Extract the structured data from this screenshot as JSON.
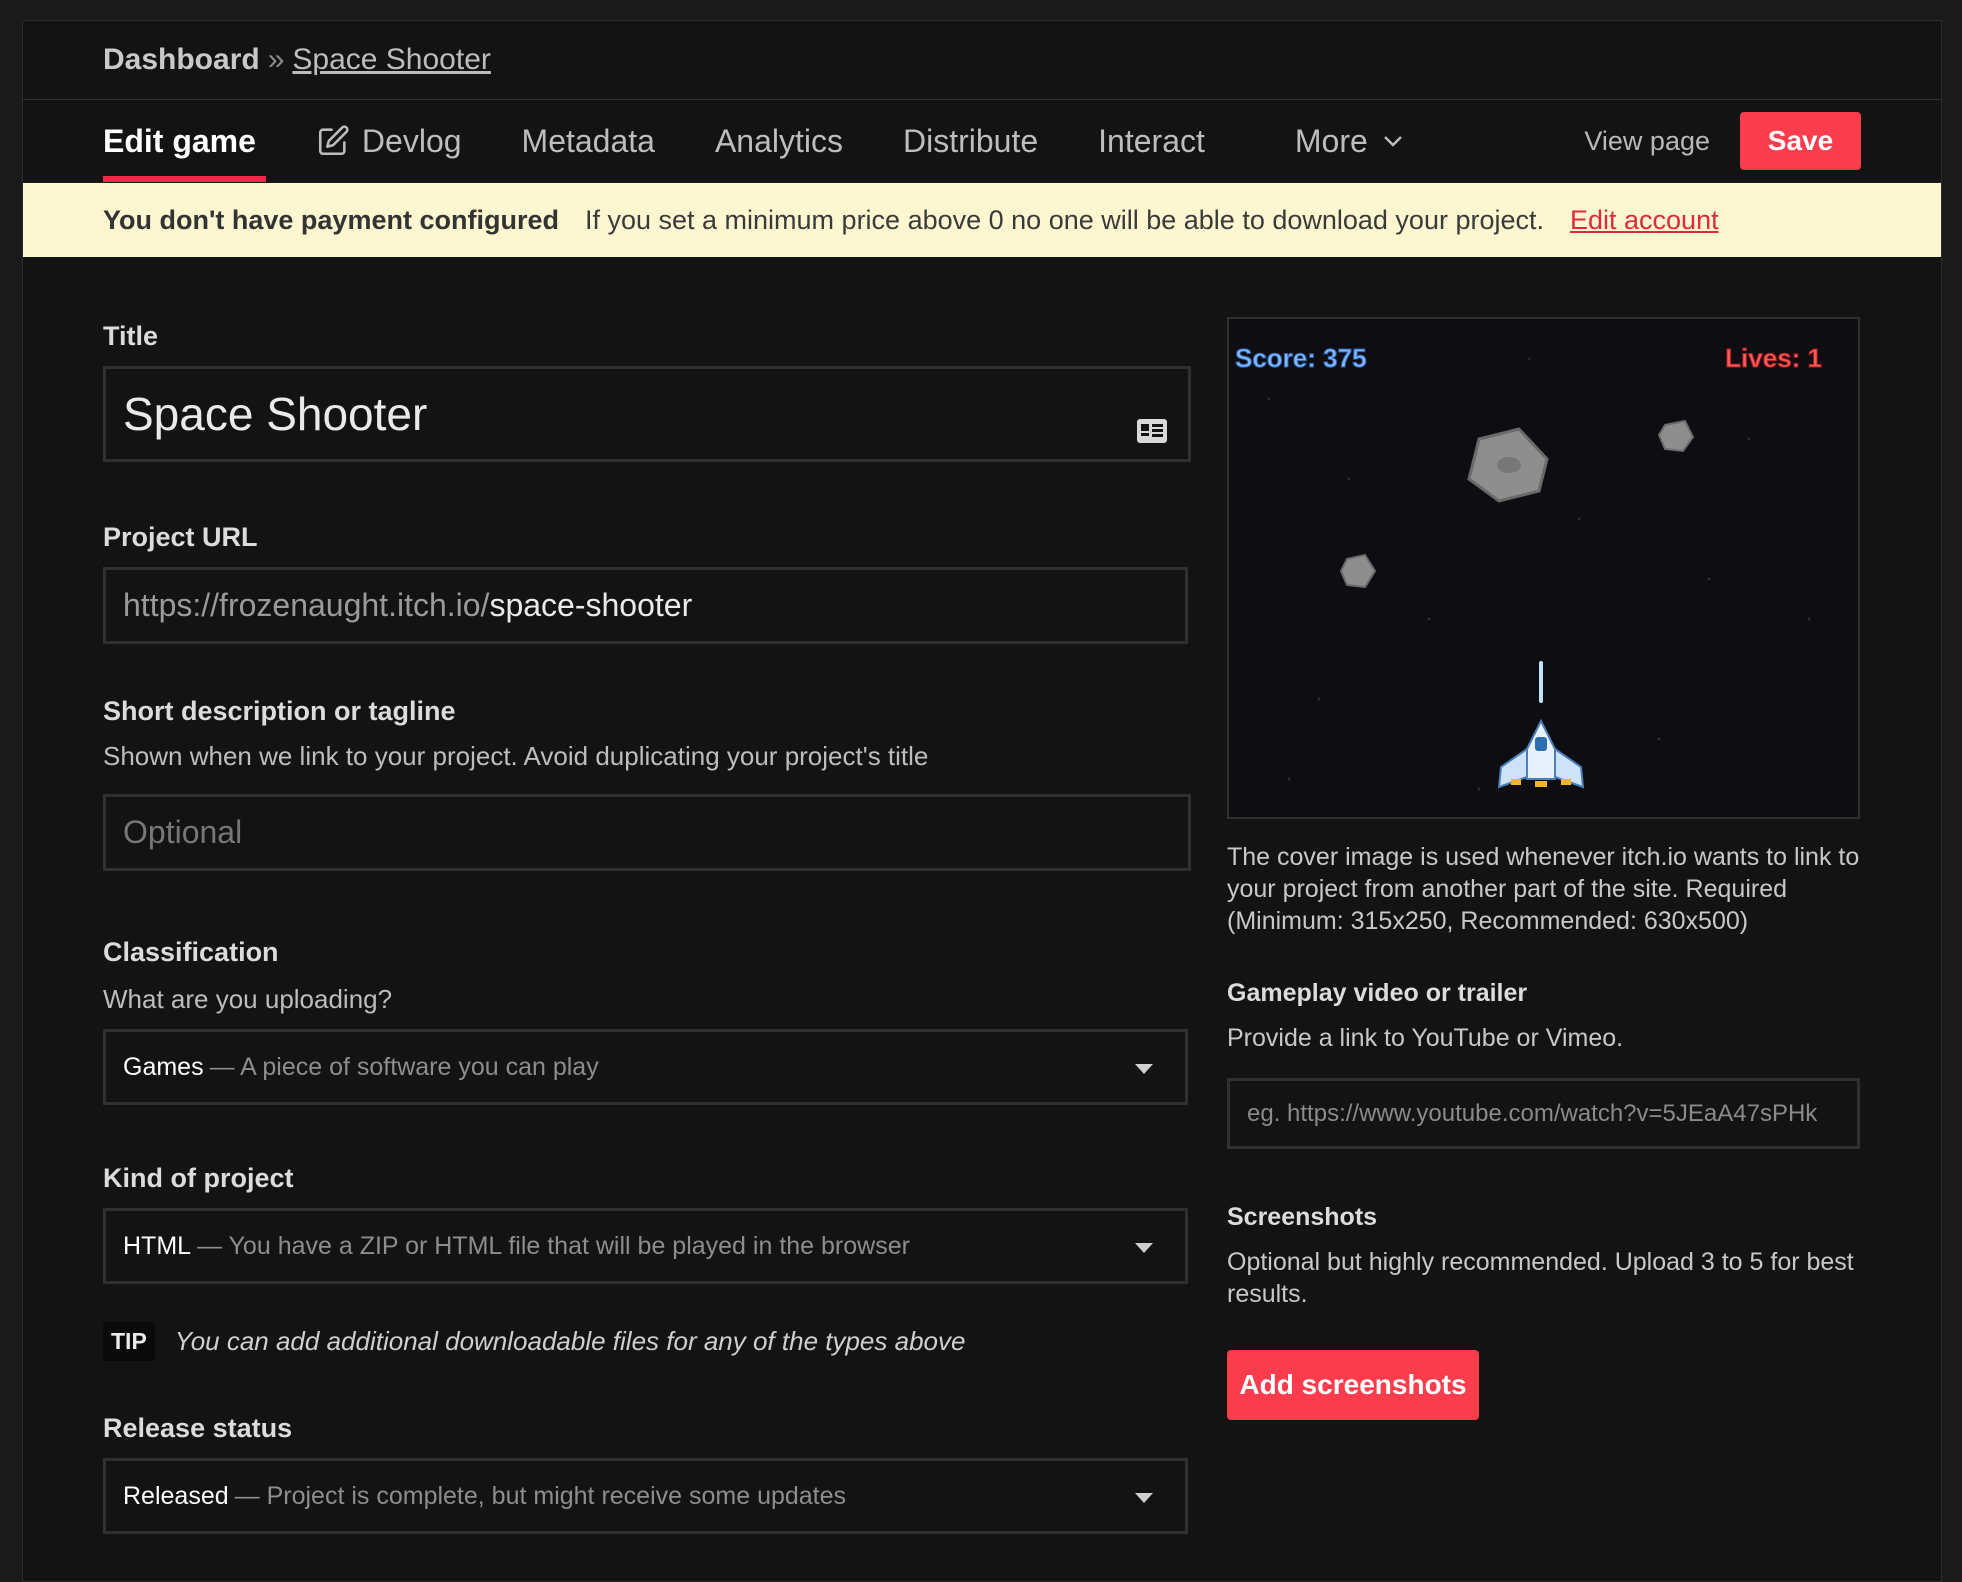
{
  "breadcrumb": {
    "root": "Dashboard",
    "separator": "»",
    "current": "Space Shooter"
  },
  "tabs": [
    {
      "label": "Edit game",
      "icon": ""
    },
    {
      "label": "Devlog",
      "icon": "edit-icon"
    },
    {
      "label": "Metadata",
      "icon": ""
    },
    {
      "label": "Analytics",
      "icon": ""
    },
    {
      "label": "Distribute",
      "icon": ""
    },
    {
      "label": "Interact",
      "icon": ""
    },
    {
      "label": "More",
      "icon": "chevron-down-icon"
    }
  ],
  "header_actions": {
    "view_page": "View page",
    "save": "Save"
  },
  "notice": {
    "title": "You don't have payment configured",
    "message": "If you set a minimum price above 0 no one will be able to download your project.",
    "link": "Edit account"
  },
  "form": {
    "title": {
      "label": "Title",
      "value": "Space Shooter"
    },
    "url": {
      "label": "Project URL",
      "prefix": "https://frozenaught.itch.io/",
      "slug": "space-shooter"
    },
    "tagline": {
      "label": "Short description or tagline",
      "help": "Shown when we link to your project. Avoid duplicating your project's title",
      "placeholder": "Optional"
    },
    "classification": {
      "label": "Classification",
      "help": "What are you uploading?",
      "value": "Games",
      "desc": "— A piece of software you can play"
    },
    "kind": {
      "label": "Kind of project",
      "value": "HTML",
      "desc": "— You have a ZIP or HTML file that will be played in the browser"
    },
    "tip": {
      "badge": "TIP",
      "text": "You can add additional downloadable files for any of the types above"
    },
    "release": {
      "label": "Release status",
      "value": "Released",
      "desc": "— Project is complete, but might receive some updates"
    }
  },
  "cover": {
    "score": "Score: 375",
    "lives": "Lives: 1",
    "help": "The cover image is used whenever itch.io wants to link to your project from another part of the site. Required (Minimum: 315x250, Recommended: 630x500)"
  },
  "video": {
    "label": "Gameplay video or trailer",
    "help": "Provide a link to YouTube or Vimeo.",
    "placeholder": "eg. https://www.youtube.com/watch?v=5JEaA47sPHk"
  },
  "screenshots": {
    "label": "Screenshots",
    "help": "Optional but highly recommended. Upload 3 to 5 for best results.",
    "button": "Add screenshots"
  },
  "colors": {
    "accent": "#fa3c4c",
    "notice_bg": "#fcf7d1",
    "page_bg": "#131313"
  }
}
